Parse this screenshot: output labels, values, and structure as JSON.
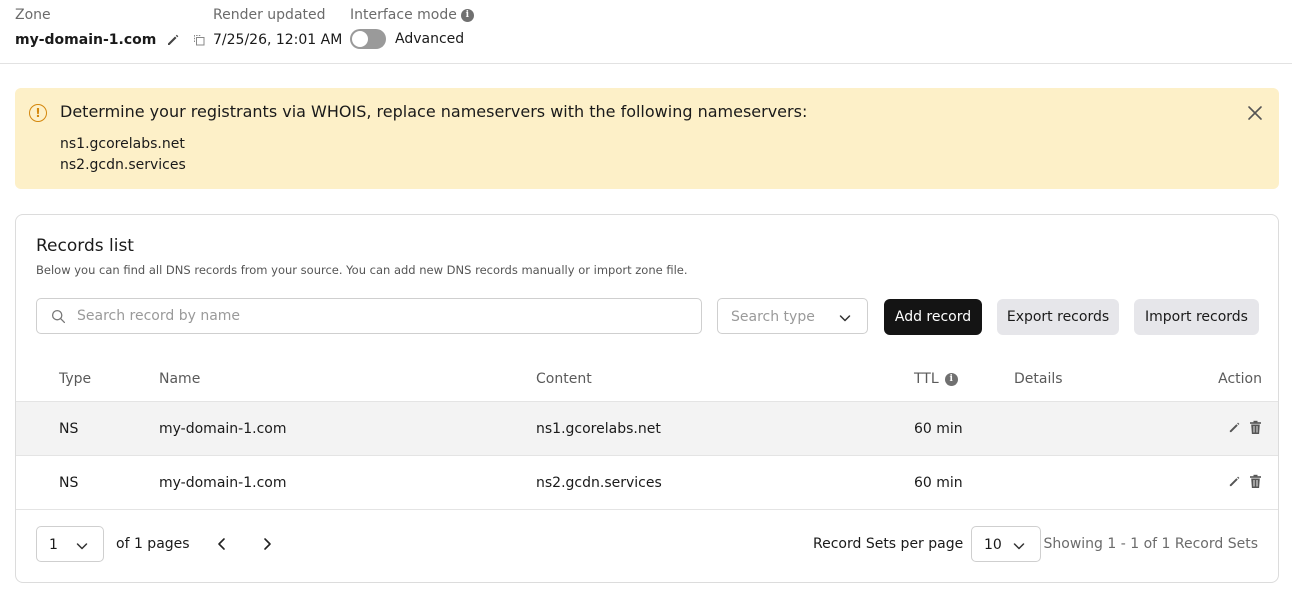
{
  "header": {
    "zone_label": "Zone",
    "zone_name": "my-domain-1.com",
    "render_label": "Render updated",
    "render_value": "7/25/26, 12:01 AM",
    "mode_label": "Interface mode",
    "mode_value": "Advanced",
    "mode_enabled": false
  },
  "banner": {
    "message": "Determine your registrants via WHOIS, replace nameservers with the following nameservers:",
    "nameservers": [
      "ns1.gcorelabs.net",
      "ns2.gcdn.services"
    ]
  },
  "records": {
    "title": "Records list",
    "subtitle": "Below you can find all DNS records from your source. You can add new DNS records manually or import zone file.",
    "search_placeholder": "Search record by name",
    "type_placeholder": "Search type",
    "add_label": "Add record",
    "export_label": "Export records",
    "import_label": "Import records",
    "columns": {
      "type": "Type",
      "name": "Name",
      "content": "Content",
      "ttl": "TTL",
      "details": "Details",
      "action": "Action"
    },
    "rows": [
      {
        "type": "NS",
        "name": "my-domain-1.com",
        "content": "ns1.gcorelabs.net",
        "ttl": "60 min",
        "details": ""
      },
      {
        "type": "NS",
        "name": "my-domain-1.com",
        "content": "ns2.gcdn.services",
        "ttl": "60 min",
        "details": ""
      }
    ]
  },
  "pagination": {
    "page_value": "1",
    "of_pages": "of 1 pages",
    "per_page_label": "Record Sets per page",
    "per_page_value": "10",
    "showing": "Showing 1 - 1 of 1 Record Sets"
  },
  "colors": {
    "banner_bg": "#fdf0c8",
    "warning_accent": "#d4870d",
    "primary_button": "#141414",
    "secondary_button": "#e6e6ea"
  }
}
